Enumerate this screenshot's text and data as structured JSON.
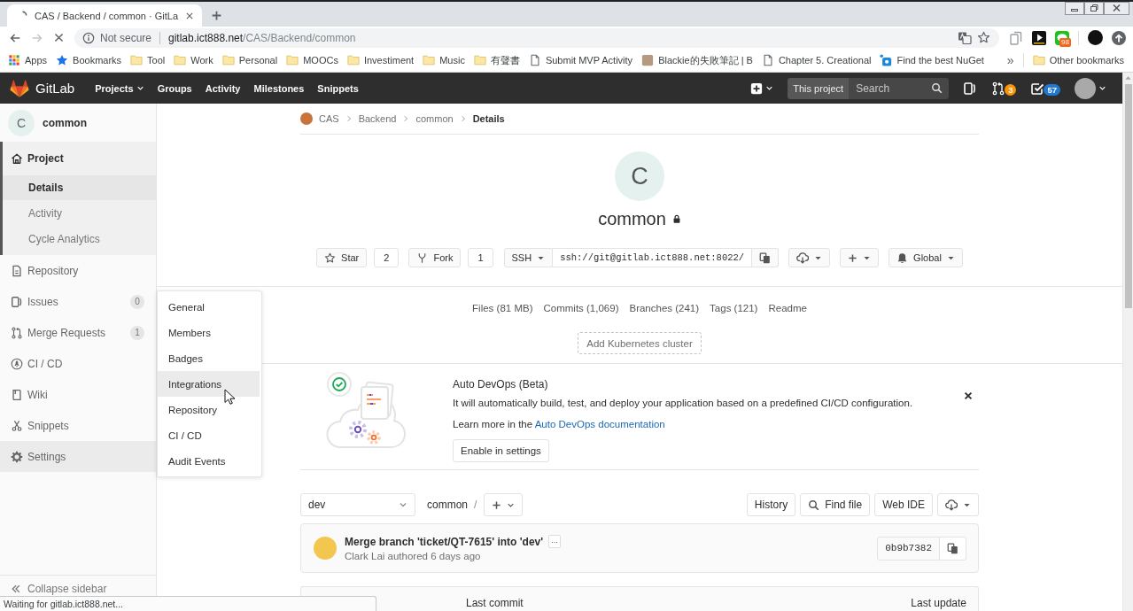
{
  "browser": {
    "tabs": [
      {
        "title": "CAS / Backend / common · GitLa",
        "selected": true,
        "loading": true
      }
    ],
    "toolbar": {
      "can_go_forward": false,
      "loading": true
    },
    "address": {
      "security": "Not secure",
      "host": "gitlab.ict888.net",
      "path": "/CAS/Backend/common"
    },
    "extension_badge": "98",
    "bookmarks": [
      {
        "kind": "apps",
        "label": "Apps"
      },
      {
        "kind": "star",
        "label": "Bookmarks"
      },
      {
        "kind": "folder",
        "label": "Tool"
      },
      {
        "kind": "folder",
        "label": "Work"
      },
      {
        "kind": "folder",
        "label": "Personal"
      },
      {
        "kind": "folder",
        "label": "MOOCs"
      },
      {
        "kind": "folder",
        "label": "Investiment"
      },
      {
        "kind": "folder",
        "label": "Music"
      },
      {
        "kind": "folder",
        "label": "有聲書"
      },
      {
        "kind": "page",
        "label": "Submit MVP Activity"
      },
      {
        "kind": "avatar",
        "label": "Blackie的失敗筆記 | B"
      },
      {
        "kind": "page",
        "label": "Chapter 5. Creational"
      },
      {
        "kind": "site",
        "label": "Find the best NuGet"
      }
    ],
    "bookmarks_overflow": "»",
    "other_bookmarks": {
      "kind": "folder",
      "label": "Other bookmarks"
    }
  },
  "navbar": {
    "brand": "GitLab",
    "links": [
      {
        "label": "Projects",
        "dropdown": true
      },
      {
        "label": "Groups",
        "dropdown": false
      },
      {
        "label": "Activity",
        "dropdown": false
      },
      {
        "label": "Milestones",
        "dropdown": false
      },
      {
        "label": "Snippets",
        "dropdown": false
      }
    ],
    "search": {
      "scope": "This project",
      "placeholder": "Search"
    },
    "merge_requests_count": "3",
    "todos_count": "57"
  },
  "sidebar": {
    "project": {
      "letter": "C",
      "name": "common"
    },
    "items": [
      {
        "kind": "project",
        "label": "Project",
        "selected": true,
        "hovered": false,
        "children": [
          {
            "label": "Details",
            "selected": true
          },
          {
            "label": "Activity",
            "selected": false
          },
          {
            "label": "Cycle Analytics",
            "selected": false
          }
        ]
      },
      {
        "kind": "repository",
        "label": "Repository",
        "selected": false,
        "hovered": false
      },
      {
        "kind": "issues",
        "label": "Issues",
        "count": "0",
        "selected": false,
        "hovered": false
      },
      {
        "kind": "merge_requests",
        "label": "Merge Requests",
        "count": "1",
        "selected": false,
        "hovered": false
      },
      {
        "kind": "cicd",
        "label": "CI / CD",
        "selected": false,
        "hovered": false
      },
      {
        "kind": "wiki",
        "label": "Wiki",
        "selected": false,
        "hovered": false
      },
      {
        "kind": "snippets",
        "label": "Snippets",
        "selected": false,
        "hovered": false
      },
      {
        "kind": "settings",
        "label": "Settings",
        "selected": false,
        "hovered": true
      }
    ],
    "collapse": "Collapse sidebar"
  },
  "settings_flyout": {
    "items": [
      {
        "label": "General",
        "hovered": false
      },
      {
        "label": "Members",
        "hovered": false
      },
      {
        "label": "Badges",
        "hovered": false
      },
      {
        "label": "Integrations",
        "hovered": true
      },
      {
        "label": "Repository",
        "hovered": false
      },
      {
        "label": "CI / CD",
        "hovered": false
      },
      {
        "label": "Audit Events",
        "hovered": false
      }
    ]
  },
  "breadcrumb": [
    {
      "label": "CAS",
      "current": false
    },
    {
      "label": "Backend",
      "current": false
    },
    {
      "label": "common",
      "current": false
    },
    {
      "label": "Details",
      "current": true
    }
  ],
  "project": {
    "letter": "C",
    "name": "common",
    "private": true
  },
  "actions": {
    "star": {
      "label": "Star",
      "count": "2"
    },
    "fork": {
      "label": "Fork",
      "count": "1"
    },
    "clone": {
      "protocol": "SSH",
      "url": "ssh://git@gitlab.ict888.net:8022/"
    },
    "notification": "Global"
  },
  "stats": [
    "Files (81 MB)",
    "Commits (1,069)",
    "Branches (241)",
    "Tags (121)",
    "Readme"
  ],
  "kubernetes_button": "Add Kubernetes cluster",
  "auto_devops": {
    "title": "Auto DevOps (Beta)",
    "text": "It will automatically build, test, and deploy your application based on a predefined CI/CD configuration.",
    "learn_more": "Learn more in the",
    "link": "Auto DevOps documentation",
    "button": "Enable in settings"
  },
  "tree": {
    "branch": "dev",
    "path": "common",
    "separator": "/",
    "buttons": [
      {
        "kind": "history",
        "label": "History"
      },
      {
        "kind": "find",
        "label": "Find file"
      },
      {
        "kind": "ide",
        "label": "Web IDE"
      }
    ]
  },
  "last_commit": {
    "title": "Merge branch 'ticket/QT-7615' into 'dev'",
    "more": "...",
    "byline": "Clark Lai authored 6 days ago",
    "sha": "0b9b7382"
  },
  "files_table": {
    "columns": [
      "Last commit",
      "Last update"
    ]
  },
  "status_bubble": "Waiting for gitlab.ict888.net..."
}
